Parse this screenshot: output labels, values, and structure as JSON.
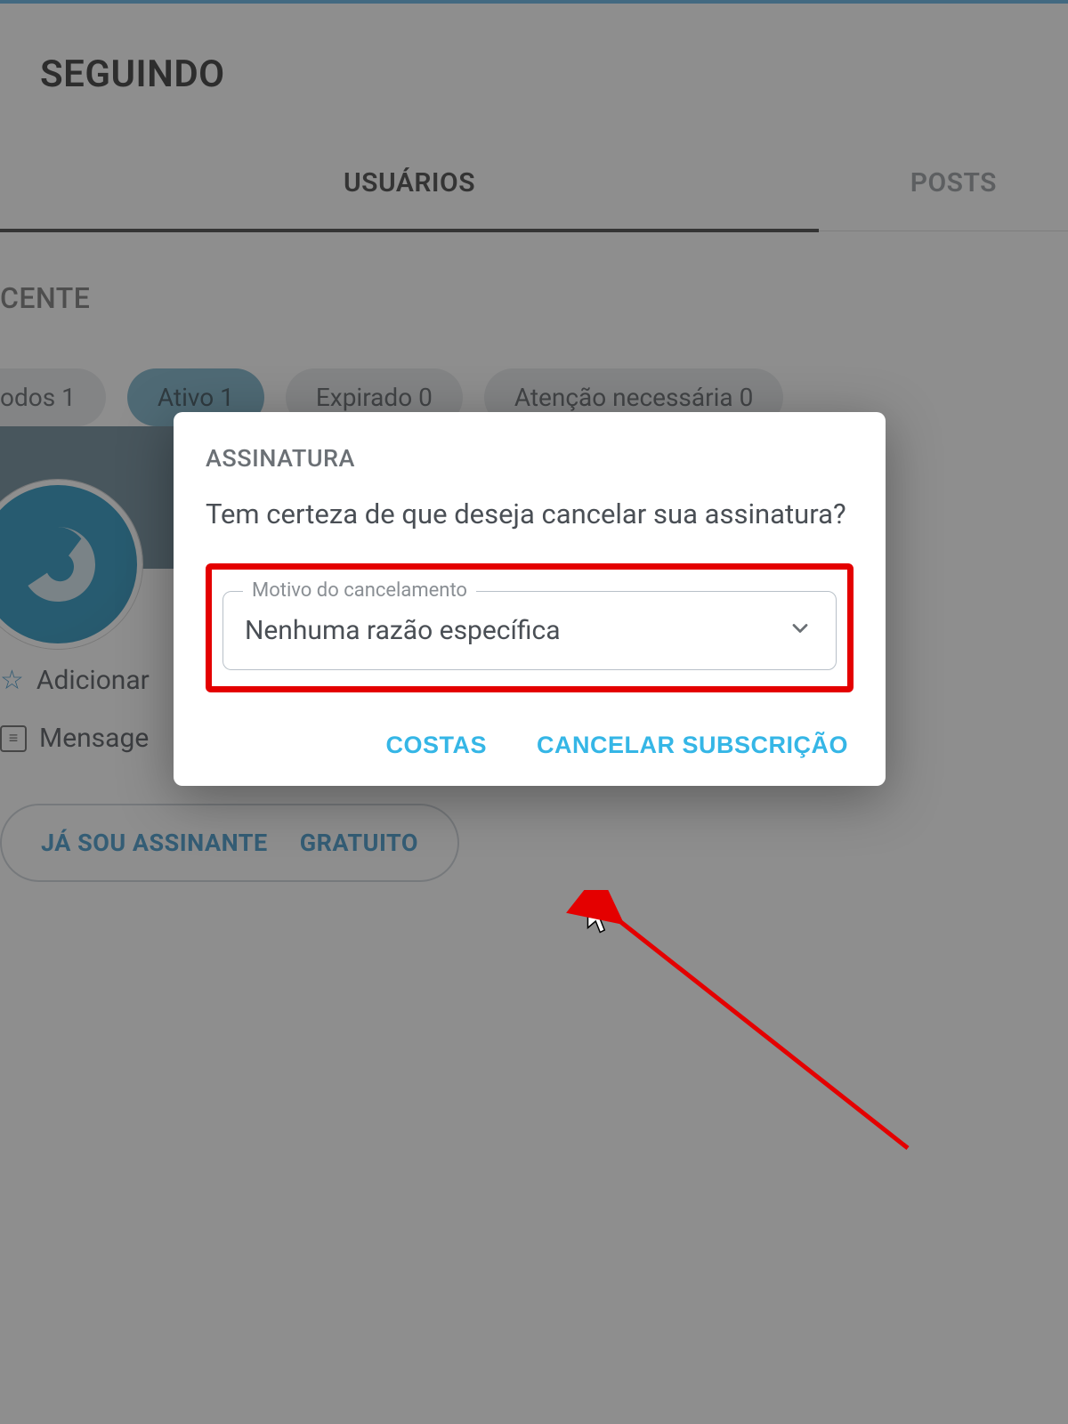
{
  "page": {
    "title": "SEGUINDO",
    "section_label": "CENTE",
    "tabs": {
      "users": "USUÁRIOS",
      "posts": "POSTS"
    },
    "chips": {
      "all": "odos 1",
      "active": "Ativo 1",
      "expired": "Expirado 0",
      "attention": "Atenção necessária 0"
    },
    "links": {
      "add": "Adicionar",
      "message": "Mensage"
    },
    "sub_pill": {
      "already": "JÁ SOU ASSINANTE",
      "free": "GRATUITO"
    }
  },
  "modal": {
    "title": "ASSINATURA",
    "body": "Tem certeza de que deseja cancelar sua assinatura?",
    "reason": {
      "legend": "Motivo do cancelamento",
      "value": "Nenhuma razão específica"
    },
    "actions": {
      "back": "COSTAS",
      "cancel": "CANCELAR SUBSCRIÇÃO"
    }
  }
}
